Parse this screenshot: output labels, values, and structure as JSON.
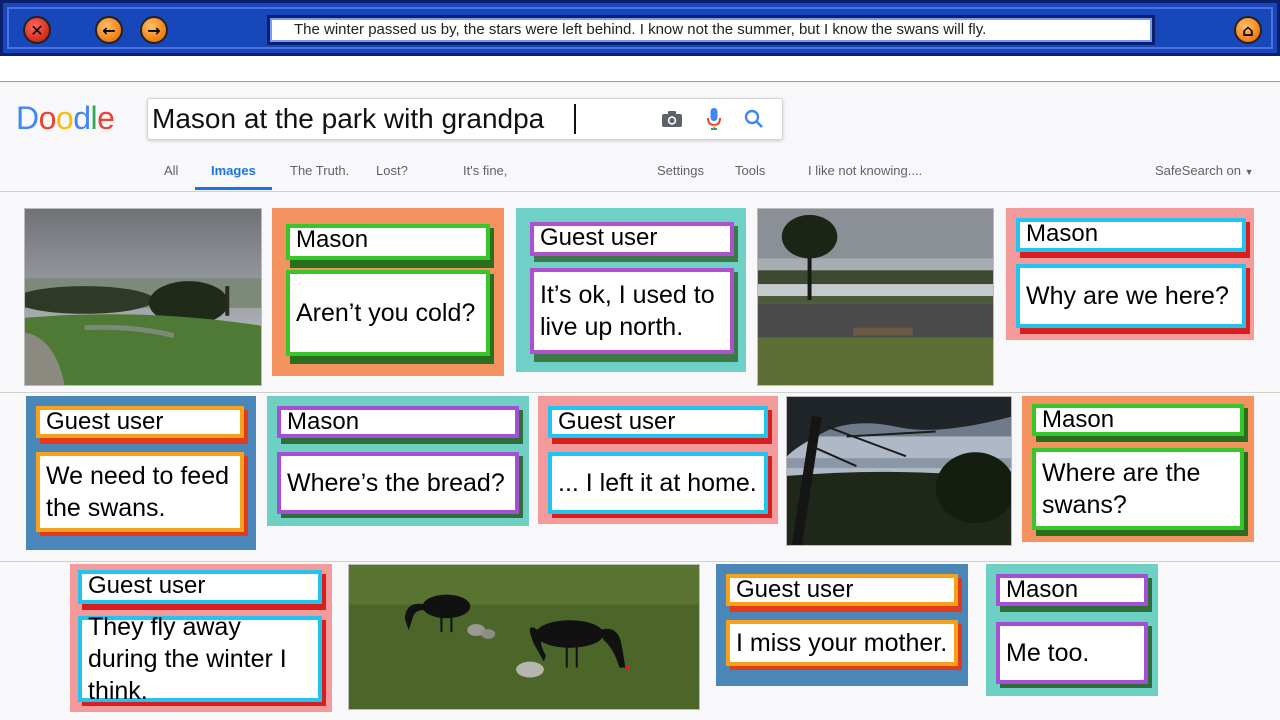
{
  "window": {
    "marquee_text": "The winter passed us by, the stars were left behind. I know not the summer, but I know the swans will fly.",
    "buttons": [
      "close",
      "back",
      "forward",
      "settings"
    ]
  },
  "logo": {
    "letters": [
      "D",
      "o",
      "o",
      "d",
      "l",
      "e"
    ],
    "colors": [
      "#4285f4",
      "#ea4335",
      "#fbbc05",
      "#4285f4",
      "#34a853",
      "#ea4335"
    ]
  },
  "search": {
    "query": "Mason at the park with grandpa",
    "icons": [
      "camera-icon",
      "microphone-icon",
      "magnifier-icon"
    ]
  },
  "nav": {
    "tabs": [
      "All",
      "Images",
      "The Truth.",
      "Lost?",
      "It's fine,",
      "Settings",
      "Tools",
      "I like not knowing...."
    ],
    "active": "Images",
    "safesearch": "SafeSearch on"
  },
  "results": {
    "row1": {
      "card1": {
        "name": "Mason",
        "message": "Aren’t you cold?"
      },
      "card2": {
        "name": "Guest user",
        "message": "It’s ok, I used to live up north."
      },
      "card3": {
        "name": "Mason",
        "message": "Why are we here?"
      }
    },
    "row2": {
      "card1": {
        "name": "Guest user",
        "message": "We need to feed the swans."
      },
      "card2": {
        "name": "Mason",
        "message": "Where’s the bread?"
      },
      "card3": {
        "name": "Guest user",
        "message": "... I left it at home."
      },
      "card4": {
        "name": "Mason",
        "message": "Where are the swans?"
      }
    },
    "row3": {
      "card1": {
        "name": "Guest user",
        "message": "They fly away during the winter I think."
      },
      "card2": {
        "name": "Guest user",
        "message": "I miss your mother."
      },
      "card3": {
        "name": "Mason",
        "message": "Me too."
      }
    }
  },
  "colors": {
    "accent": "#1a73e8",
    "titlebar": "#1747b8"
  }
}
